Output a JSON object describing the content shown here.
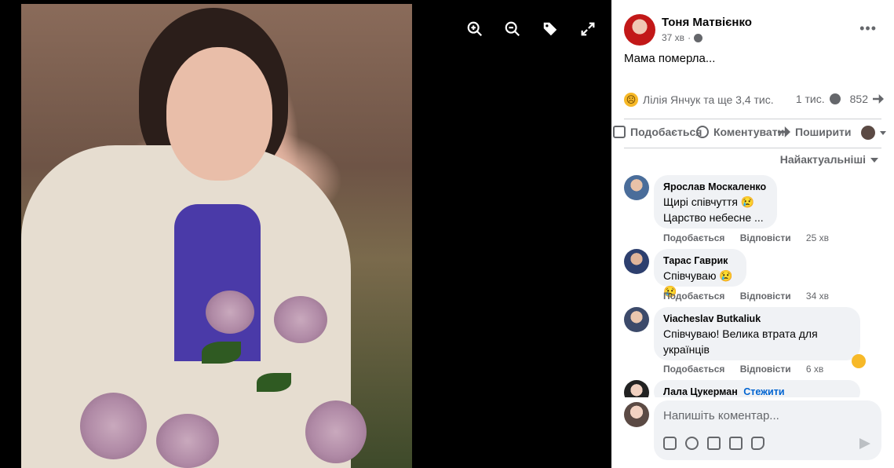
{
  "post": {
    "author": "Тоня Матвієнко",
    "time": "37 хв",
    "text": "Мама померла...",
    "reactions_text": "Лілія Янчук та ще 3,4 тис.",
    "comments_count": "1 тис.",
    "shares_count": "852"
  },
  "actions": {
    "like": "Подобається",
    "comment": "Коментувати",
    "share": "Поширити"
  },
  "sort_label": "Найактуальніші",
  "comments": [
    {
      "name": "Ярослав Москаленко",
      "lines": [
        "Щирі співчуття 😢",
        "Царство небесне ..."
      ],
      "like": "Подобається",
      "reply": "Відповісти",
      "time": "25 хв"
    },
    {
      "name": "Тарас Гаврик",
      "lines": [
        "Співчуваю 😢 😢"
      ],
      "like": "Подобається",
      "reply": "Відповісти",
      "time": "34 хв"
    },
    {
      "name": "Viacheslav Butkaliuk",
      "lines": [
        "Співчуваю! Велика втрата для",
        "українців"
      ],
      "like": "Подобається",
      "reply": "Відповісти",
      "time": "6 хв"
    },
    {
      "name": "Лала Цукерман",
      "follow": "Стежити"
    }
  ],
  "composer": {
    "placeholder": "Напишіть коментар..."
  },
  "icons": [
    "zoom-in-icon",
    "zoom-out-icon",
    "tag-icon",
    "fullscreen-icon"
  ],
  "colors": {
    "accent": "#0064d1",
    "panel_bg": "#ffffff",
    "bubble_bg": "#f0f2f5"
  }
}
